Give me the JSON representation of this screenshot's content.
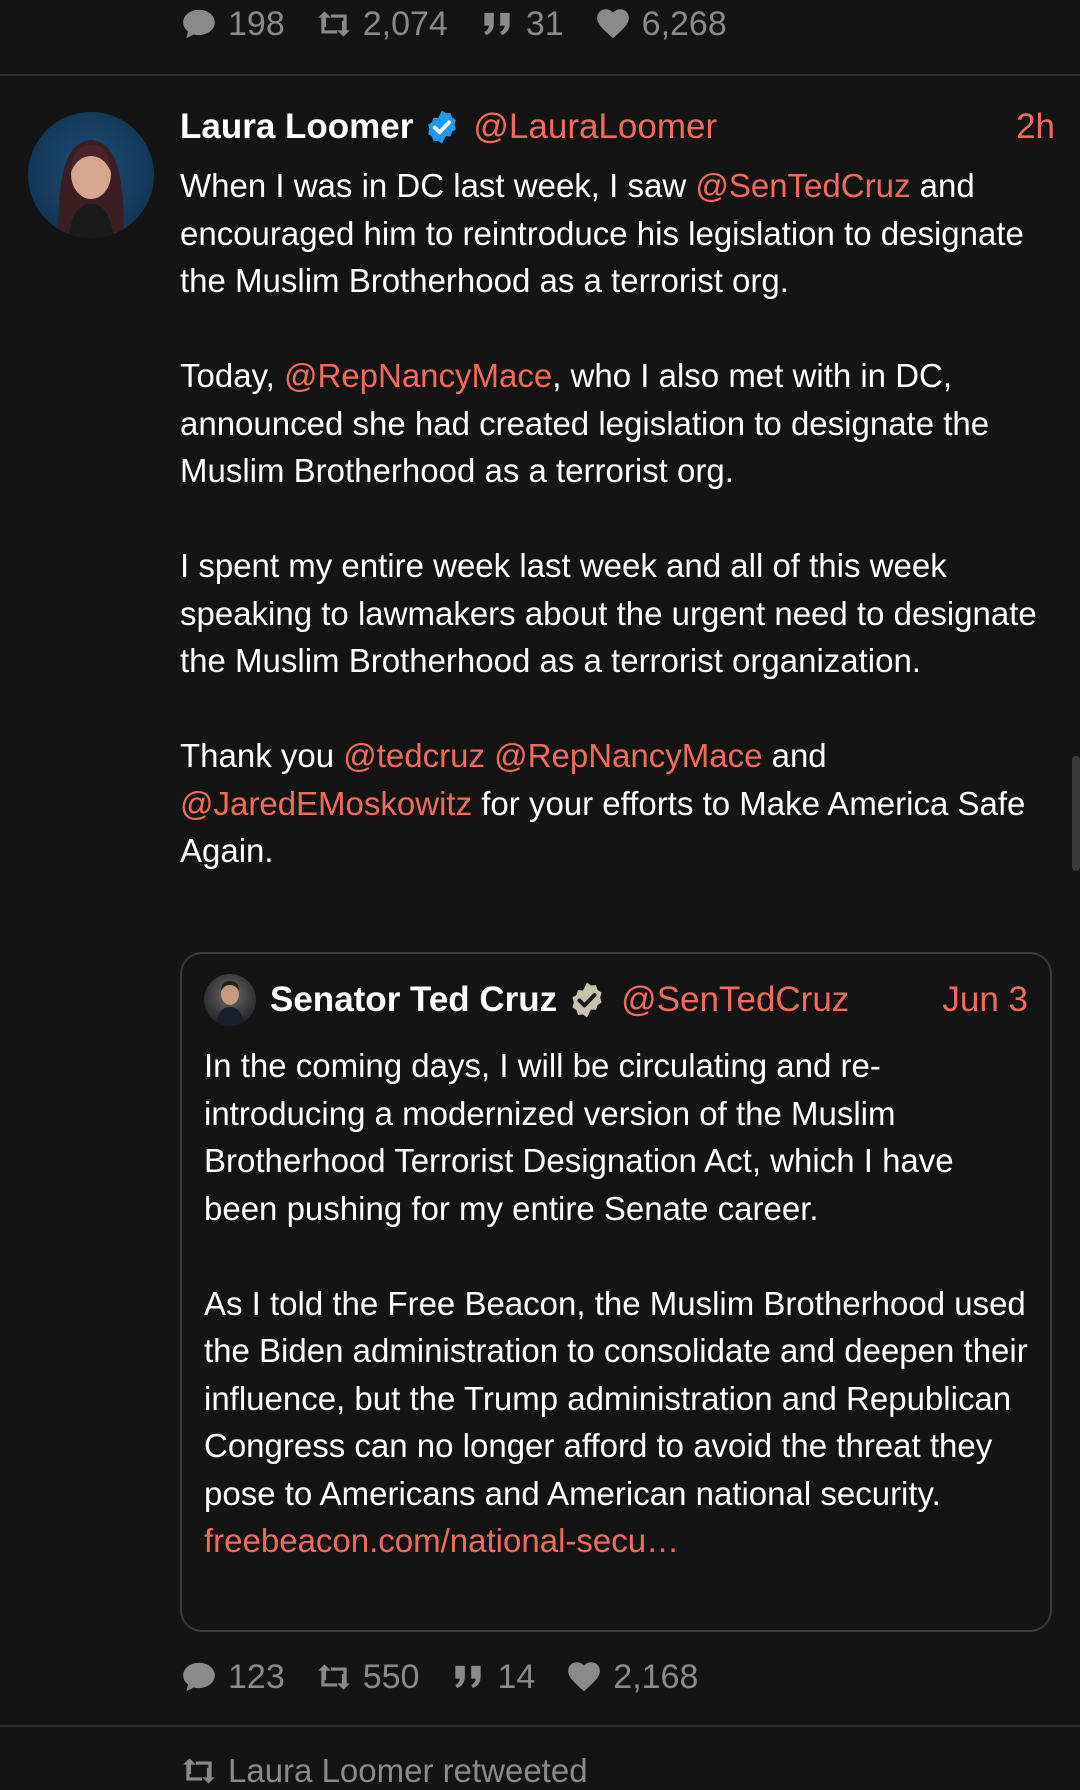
{
  "top_stats": {
    "replies": "198",
    "retweets": "2,074",
    "quotes": "31",
    "likes": "6,268"
  },
  "tweet": {
    "name": "Laura Loomer",
    "handle": "@LauraLoomer",
    "time": "2h",
    "p1": {
      "a": "When I was in DC last week, I saw ",
      "m1": "@SenTedCruz",
      "b": " and encouraged him to reintroduce his legislation to designate the Muslim Brotherhood as a terrorist org."
    },
    "p2": {
      "a": "Today, ",
      "m1": "@RepNancyMace",
      "b": ", who I also met with in DC, announced she had created legislation to designate the Muslim Brotherhood as a terrorist org."
    },
    "p3": "I spent my entire week last week and all of this week speaking to lawmakers about the urgent need to designate the Muslim Brotherhood as a terrorist organization.",
    "p4": {
      "a": "Thank you ",
      "m1": "@tedcruz",
      "sp": " ",
      "m2": "@RepNancyMace",
      "b": " and ",
      "m3": "@JaredEMoskowitz",
      "c": " for your efforts to Make America Safe Again."
    }
  },
  "quote": {
    "name": "Senator Ted Cruz",
    "handle": "@SenTedCruz",
    "time": "Jun 3",
    "p1": "In the coming days, I will be circulating and re-introducing a modernized version of the Muslim Brotherhood Terrorist Designation Act, which I have been pushing for my entire Senate career.",
    "p2": "As I told the Free Beacon, the Muslim Brotherhood used the Biden administration to consolidate and deepen their influence, but the Trump administration and Republican Congress can no longer afford to avoid the threat they pose to Americans and American national security.",
    "link": "freebeacon.com/national-secu…"
  },
  "bottom_stats": {
    "replies": "123",
    "retweets": "550",
    "quotes": "14",
    "likes": "2,168"
  },
  "next_item": {
    "retweeted_by": "Laura Loomer retweeted"
  },
  "colors": {
    "background": "#141414",
    "accent": "#f16a5d",
    "muted": "#8a8a8a",
    "verified_blue": "#1d9bf0",
    "verified_gray": "#c9c1b0"
  },
  "icons": {
    "reply": "comment-icon",
    "retweet": "retweet-icon",
    "quote": "quote-icon",
    "like": "heart-icon",
    "verified": "verified-badge-icon"
  }
}
